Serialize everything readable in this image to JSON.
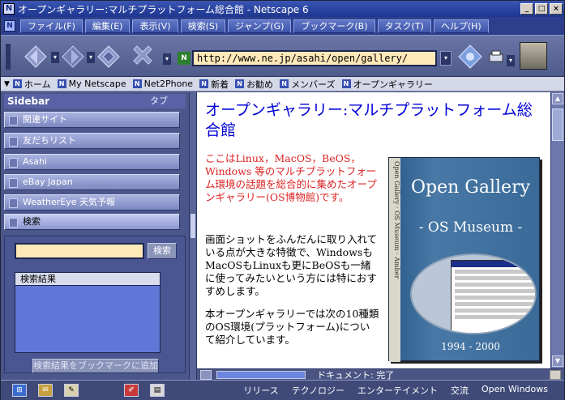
{
  "window": {
    "title": "オープンギャラリー:マルチプラットフォーム総合館 - Netscape 6",
    "controls": [
      "_",
      "□",
      "×"
    ]
  },
  "menubar": {
    "items": [
      "ファイル(F)",
      "編集(E)",
      "表示(V)",
      "検索(S)",
      "ジャンプ(G)",
      "ブックマーク(B)",
      "タスク(T)",
      "ヘルプ(H)"
    ]
  },
  "navbar": {
    "url": "http://www.ne.jp/asahi/open/gallery/"
  },
  "personal_toolbar": {
    "items": [
      "ホーム",
      "My Netscape",
      "Net2Phone",
      "新着",
      "お勧め",
      "メンバーズ",
      "オープンギャラリー"
    ]
  },
  "sidebar": {
    "title": "Sidebar",
    "tabs_label": "タブ",
    "panels": [
      "関連サイト",
      "友だちリスト",
      "Asahi",
      "eBay Japan",
      "WeatherEye 天気予報",
      "検索"
    ],
    "search_button": "検索",
    "results_header": "検索結果",
    "bookmark_button": "検索結果をブックマークに追加"
  },
  "content": {
    "heading": "オープンギャラリー:マルチプラットフォーム総合館",
    "paragraph1": "ここはLinux，MacOS，BeOS，Windows 等のマルチプラットフォーム環境の話題を総合的に集めたオープンギャラリー(OS博物館)です。",
    "paragraph2": "画面ショットをふんだんに取り入れている点が大きな特徴で、WindowsもMacOSもLinuxも更にBeOSも一緒に使ってみたいという方には特におすすめします。",
    "paragraph3": "本オープンギャラリーでは次の10種類のOS環境(プラットフォーム)について紹介しています。",
    "book": {
      "spine": "Open Gallery · OS Museum ·     Amber",
      "title": "Open Gallery",
      "subtitle": "- OS Museum -",
      "years": "1994 - 2000"
    }
  },
  "statusbar": {
    "text": "ドキュメント: 完了"
  },
  "taskbar": {
    "links": [
      "リリース",
      "テクノロジー",
      "エンターテイメント",
      "交流",
      "Open Windows"
    ]
  },
  "colors": {
    "heading": "#0000d8",
    "intro_text": "#d22222",
    "url_field": "#ffe9b9",
    "title_bar": "#1e3690"
  }
}
